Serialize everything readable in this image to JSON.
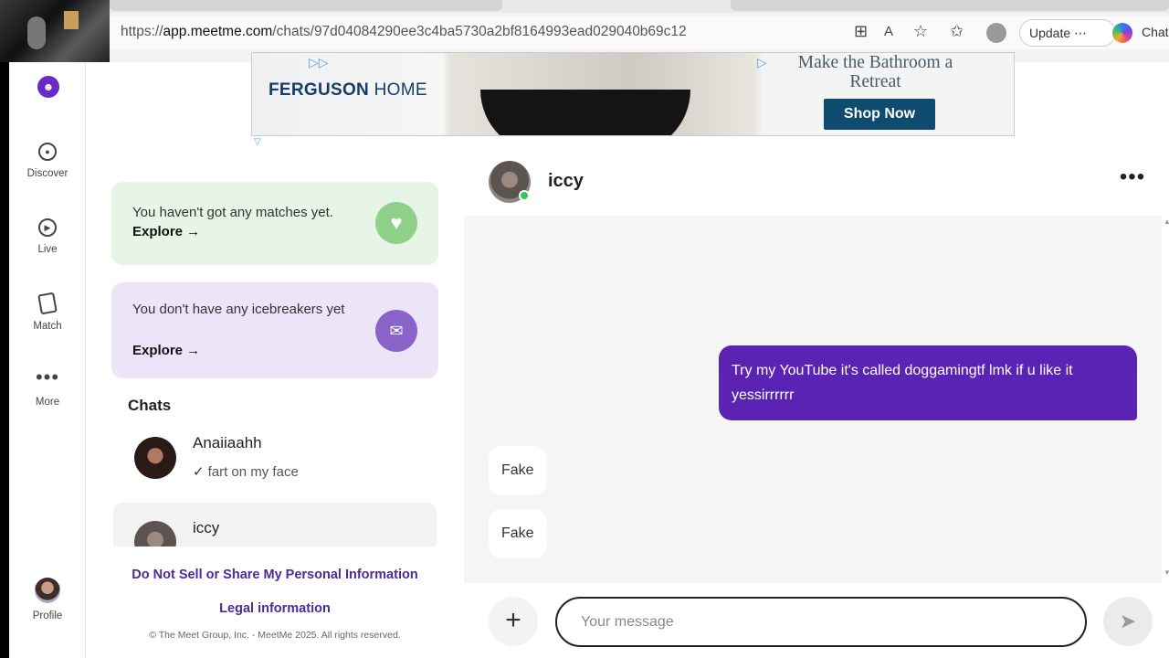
{
  "browser": {
    "url_prefix": "https://",
    "url_host": "app.meetme.com",
    "url_path": "/chats/97d04084290ee3c4ba5730a2bf8164993ead029040b69c12",
    "update_label": "Update ⋯",
    "chat_label": "Chat"
  },
  "nav": {
    "items": [
      {
        "label": "Discover",
        "icon": "map-pin-icon"
      },
      {
        "label": "Live",
        "icon": "play-circle-icon"
      },
      {
        "label": "Match",
        "icon": "cards-icon"
      },
      {
        "label": "More",
        "icon": "more-dots-icon"
      }
    ],
    "profile_label": "Profile"
  },
  "ad": {
    "brand_bold": "FERGUSON",
    "brand_light": " HOME",
    "headline": "Make the Bathroom a Retreat",
    "cta": "Shop Now"
  },
  "matches_card": {
    "text": "You haven't got any matches yet.",
    "link": "Explore →",
    "icon": "heart-icon",
    "color": "#8fd18a"
  },
  "icebreakers_card": {
    "text": "You don't have any icebreakers yet",
    "link": "Explore →",
    "icon": "envelope-icon",
    "color": "#8a63c9"
  },
  "chats": {
    "heading": "Chats",
    "items": [
      {
        "name": "Anaiiaahh",
        "preview": "fart on my face",
        "tick": "✓"
      },
      {
        "name": "iccy",
        "preview": ""
      }
    ]
  },
  "footer": {
    "privacy_link": "Do Not Sell or Share My Personal Information",
    "legal_link": "Legal information",
    "copyright": "© The Meet Group, Inc. - MeetMe 2025. All rights reserved."
  },
  "conversation": {
    "name": "iccy",
    "status": "online",
    "messages": [
      {
        "direction": "outgoing",
        "text": "Try my YouTube it's called doggamingtf lmk if u like it yessirrrrrr"
      },
      {
        "direction": "incoming",
        "text": "Fake"
      },
      {
        "direction": "incoming",
        "text": "Fake"
      }
    ],
    "accent": "#5b23b3"
  },
  "composer": {
    "placeholder": "Your message"
  }
}
